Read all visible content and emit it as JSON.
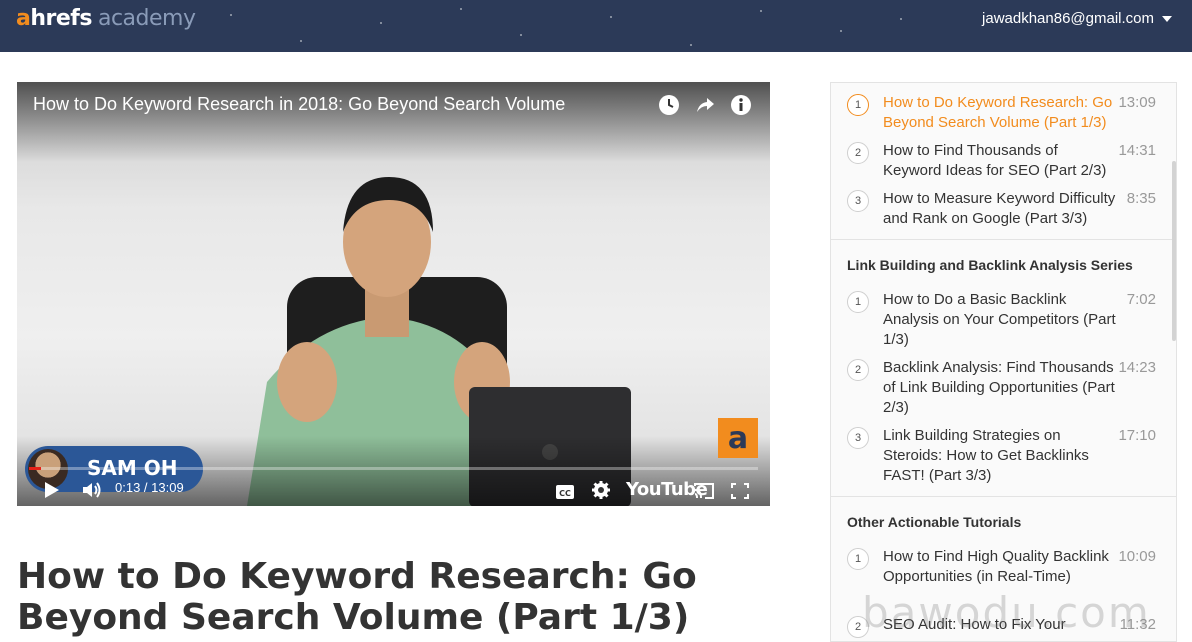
{
  "header": {
    "logo_a": "a",
    "logo_hrefs": "hrefs",
    "logo_academy": "academy",
    "user_email": "jawadkhan86@gmail.com",
    "bg_color": "#2c3a58",
    "accent_color": "#f28c1e"
  },
  "video": {
    "title": "How to Do Keyword Research in 2018: Go Beyond Search Volume",
    "time": "0:13 / 13:09",
    "presenter_name": "SAM OH",
    "brand_badge": "a",
    "youtube_label": "YouTube",
    "progress_fraction": 0.0165,
    "icons": [
      "watch-later-icon",
      "share-icon",
      "info-icon",
      "play-icon",
      "volume-icon",
      "captions-icon",
      "settings-icon",
      "cast-icon",
      "fullscreen-icon"
    ]
  },
  "page_title": "How to Do Keyword Research: Go Beyond Search Volume (Part 1/3)",
  "playlist": {
    "sections": [
      {
        "title": "",
        "items": [
          {
            "num": "1",
            "title": "How to Do Keyword Research: Go Beyond Search Volume (Part 1/3)",
            "duration": "13:09",
            "active": true
          },
          {
            "num": "2",
            "title": "How to Find Thousands of Keyword Ideas for SEO (Part 2/3)",
            "duration": "14:31",
            "active": false
          },
          {
            "num": "3",
            "title": "How to Measure Keyword Difficulty and Rank on Google (Part 3/3)",
            "duration": "8:35",
            "active": false
          }
        ]
      },
      {
        "title": "Link Building and Backlink Analysis Series",
        "items": [
          {
            "num": "1",
            "title": "How to Do a Basic Backlink Analysis on Your Competitors (Part 1/3)",
            "duration": "7:02",
            "active": false
          },
          {
            "num": "2",
            "title": "Backlink Analysis: Find Thousands of Link Building Opportunities (Part 2/3)",
            "duration": "14:23",
            "active": false
          },
          {
            "num": "3",
            "title": "Link Building Strategies on Steroids: How to Get Backlinks FAST! (Part 3/3)",
            "duration": "17:10",
            "active": false
          }
        ]
      },
      {
        "title": "Other Actionable Tutorials",
        "items": [
          {
            "num": "1",
            "title": "How to Find High Quality Backlink Opportunities (in Real-Time)",
            "duration": "10:09",
            "active": false
          },
          {
            "num": "2",
            "title": "SEO Audit: How to Fix Your",
            "duration": "11:32",
            "active": false
          }
        ]
      }
    ]
  },
  "watermark": "bawodu.com"
}
